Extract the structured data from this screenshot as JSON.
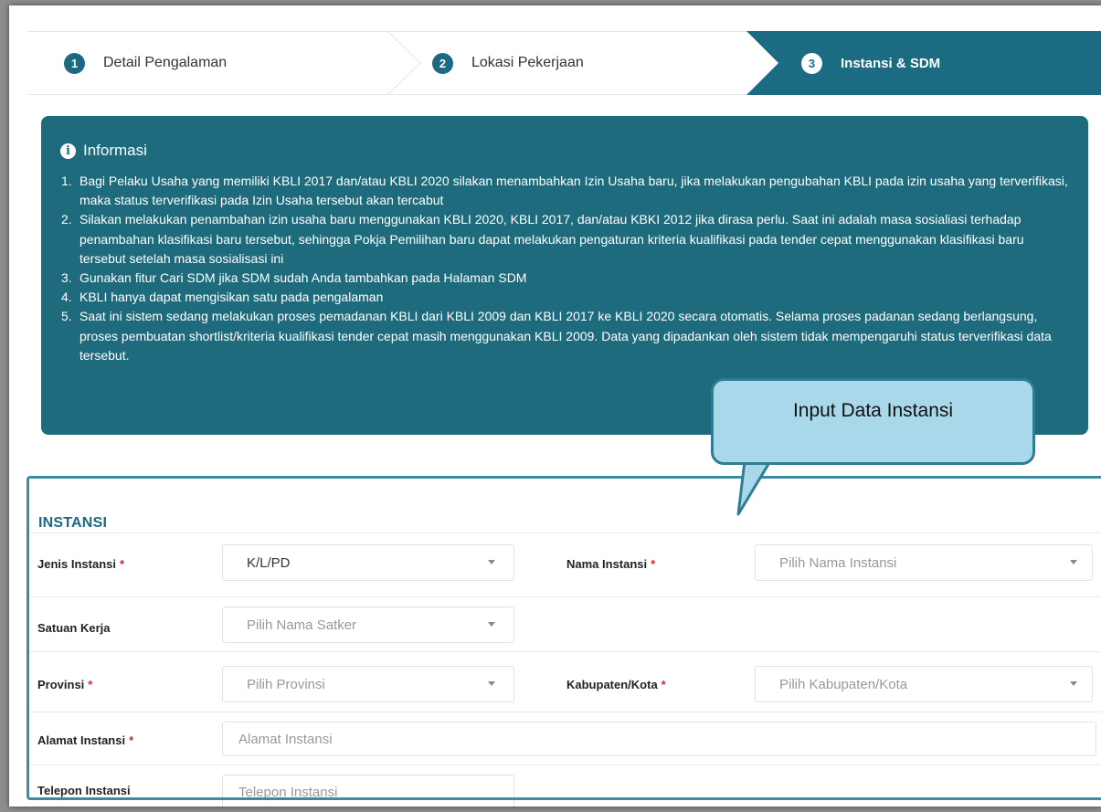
{
  "stepper": {
    "steps": [
      {
        "num": "1",
        "label": "Detail Pengalaman"
      },
      {
        "num": "2",
        "label": "Lokasi Pekerjaan"
      },
      {
        "num": "3",
        "label": "Instansi & SDM"
      }
    ],
    "active_step": 3
  },
  "info": {
    "icon": "info-circle-icon",
    "title": "Informasi",
    "items": [
      {
        "num": "1.",
        "text": "Bagi Pelaku Usaha yang memiliki KBLI 2017 dan/atau KBLI 2020 silakan menambahkan Izin Usaha baru, jika melakukan pengubahan KBLI pada izin usaha yang terverifikasi, maka status terverifikasi pada Izin Usaha tersebut akan tercabut"
      },
      {
        "num": "2.",
        "text": "Silakan melakukan penambahan izin usaha baru menggunakan KBLI 2020, KBLI 2017, dan/atau KBKI 2012 jika dirasa perlu. Saat ini adalah masa sosialiasi terhadap penambahan klasifikasi baru tersebut, sehingga Pokja Pemilihan baru dapat melakukan pengaturan kriteria kualifikasi pada tender cepat menggunakan klasifikasi baru tersebut setelah masa sosialisasi ini"
      },
      {
        "num": "3.",
        "text": "Gunakan fitur Cari SDM jika SDM sudah Anda tambahkan pada Halaman SDM"
      },
      {
        "num": "4.",
        "text": "KBLI hanya dapat mengisikan satu pada pengalaman"
      },
      {
        "num": "5.",
        "text": "Saat ini sistem sedang melakukan proses pemadanan KBLI dari KBLI 2009 dan KBLI 2017 ke KBLI 2020 secara otomatis. Selama proses padanan sedang berlangsung, proses pembuatan shortlist/kriteria kualifikasi tender cepat masih menggunakan KBLI 2009. Data yang dipadankan oleh sistem tidak mempengaruhi status terverifikasi data tersebut."
      }
    ]
  },
  "callout": {
    "text": "Input Data Instansi"
  },
  "form": {
    "heading": "INSTANSI",
    "required_mark": "*",
    "jenis_instansi": {
      "label": "Jenis Instansi",
      "value": "K/L/PD"
    },
    "nama_instansi": {
      "label": "Nama Instansi",
      "placeholder": "Pilih Nama Instansi"
    },
    "satuan_kerja": {
      "label": "Satuan Kerja",
      "placeholder": "Pilih Nama Satker"
    },
    "provinsi": {
      "label": "Provinsi",
      "placeholder": "Pilih Provinsi"
    },
    "kabupaten_kota": {
      "label": "Kabupaten/Kota",
      "placeholder": "Pilih Kabupaten/Kota"
    },
    "alamat_instansi": {
      "label": "Alamat Instansi",
      "placeholder": "Alamat Instansi"
    },
    "telepon_instansi": {
      "label": "Telepon Instansi",
      "placeholder": "Telepon Instansi"
    }
  },
  "colors": {
    "primary": "#1b6b83",
    "info_bg": "#1e6b7d",
    "required": "#d9262c",
    "callout_bg": "#a9d8ea",
    "callout_border": "#2e7d91"
  }
}
